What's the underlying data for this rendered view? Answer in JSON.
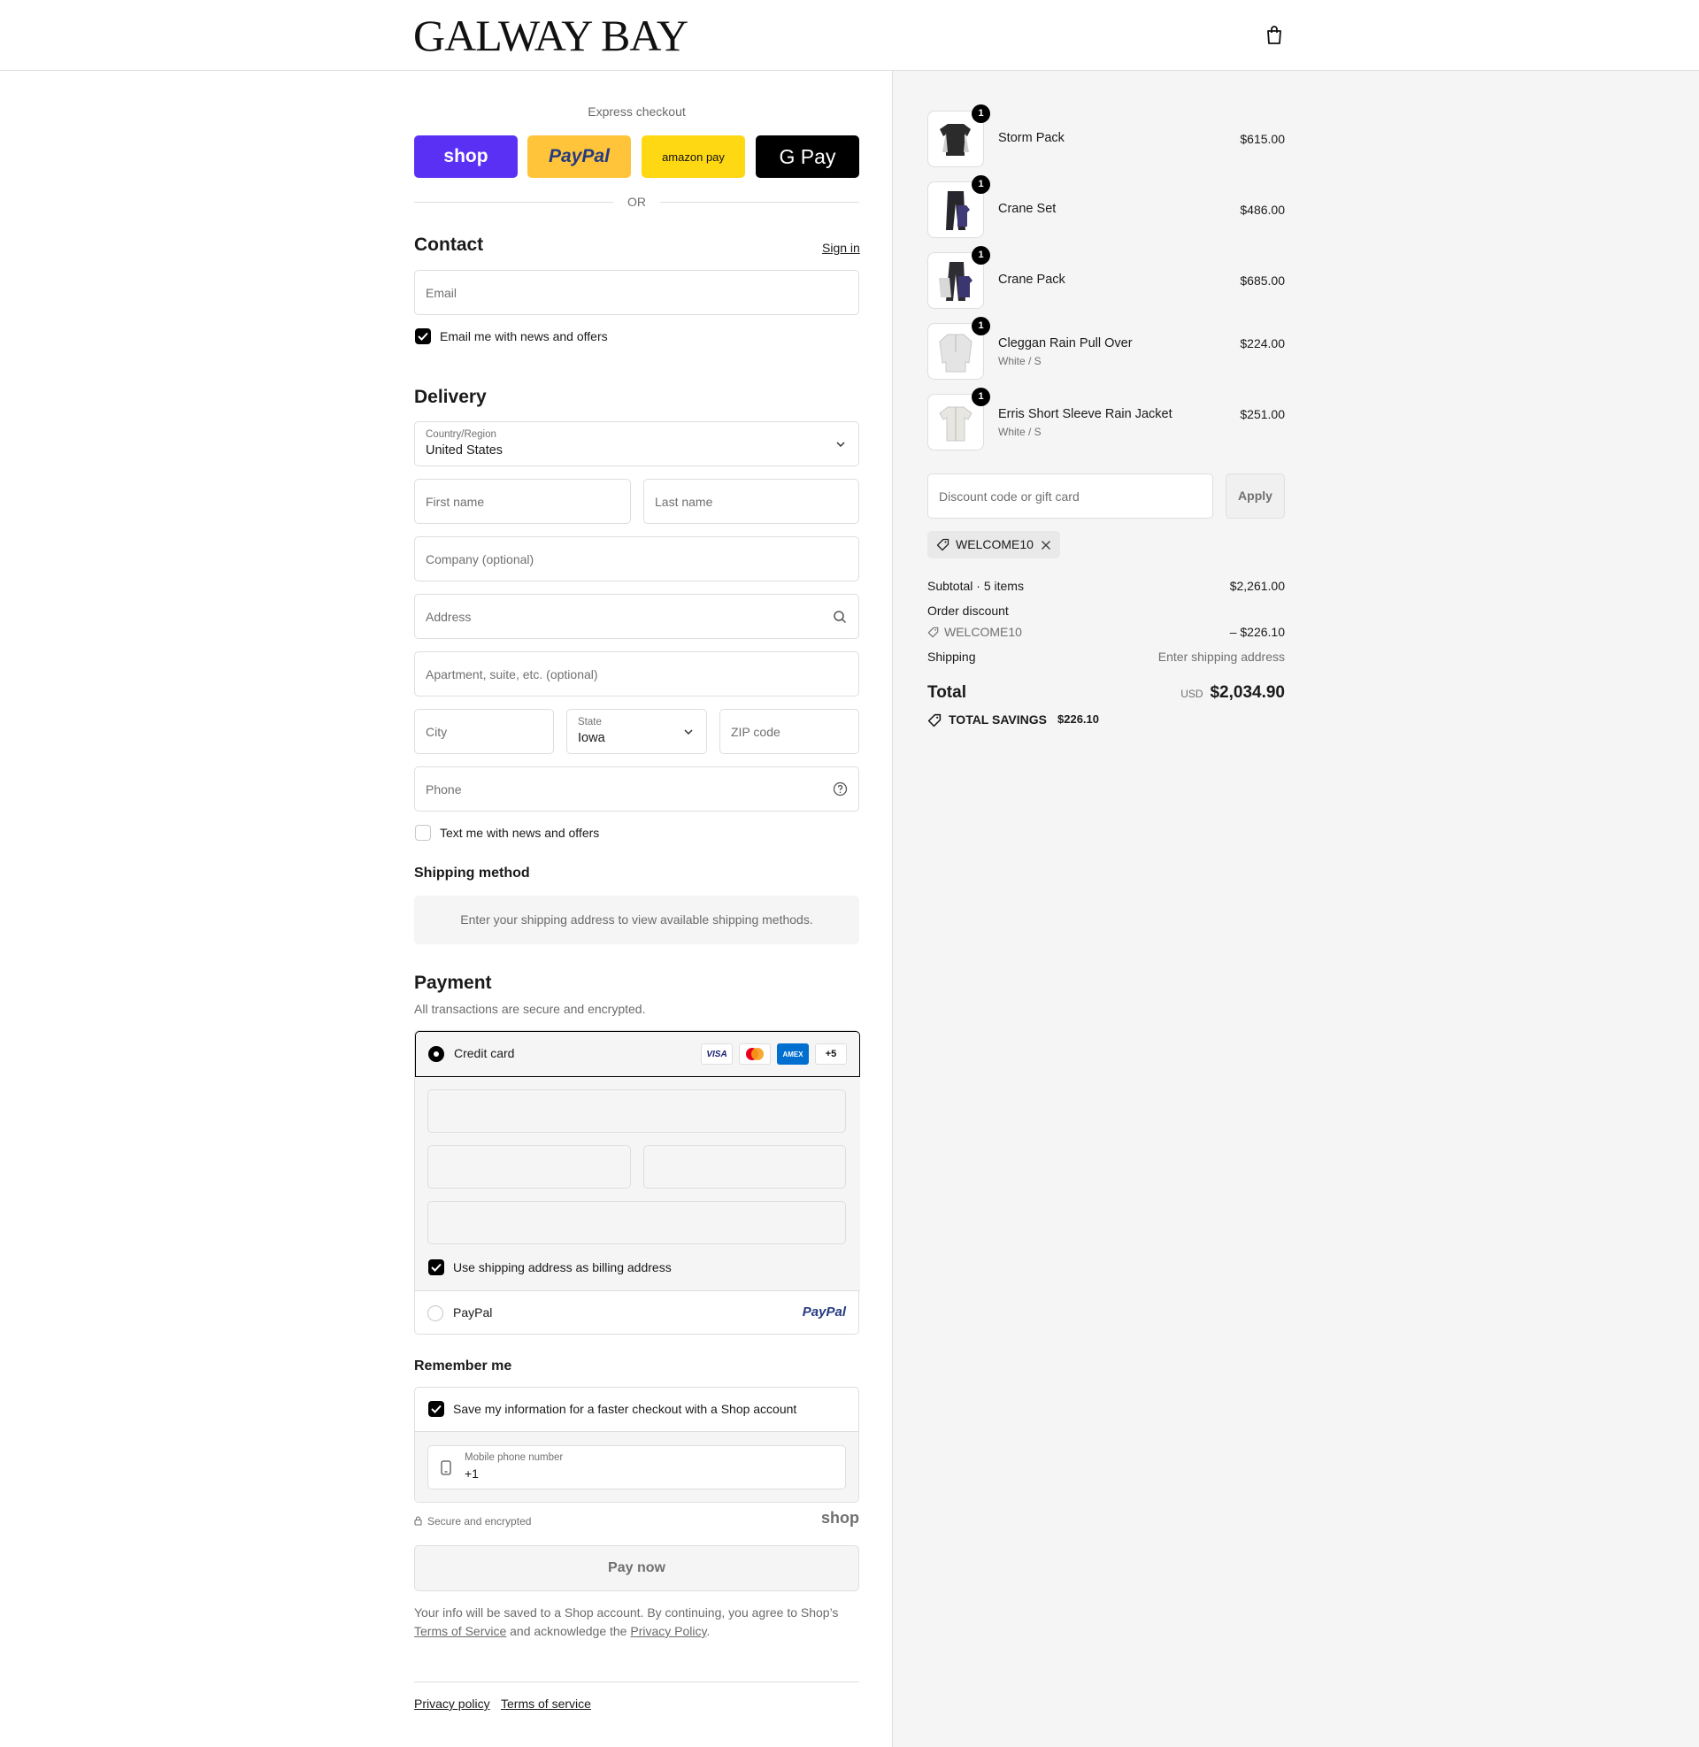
{
  "header": {
    "logo": "GALWAY BAY",
    "cart_icon": "bag-icon"
  },
  "express": {
    "title": "Express checkout",
    "buttons": [
      {
        "label": "shop",
        "color": "#5a31f4",
        "text_color": "#ffffff"
      },
      {
        "label": "PayPal",
        "color": "#ffc439",
        "text_color": "#253b80"
      },
      {
        "label": "amazon pay",
        "color": "#ffd814",
        "text_color": "#111111"
      },
      {
        "label": "G Pay",
        "color": "#000000",
        "text_color": "#ffffff"
      }
    ],
    "or": "OR"
  },
  "contact": {
    "title": "Contact",
    "sign_in": "Sign in",
    "email_placeholder": "Email",
    "news_label": "Email me with news and offers"
  },
  "delivery": {
    "title": "Delivery",
    "country_label": "Country/Region",
    "country_value": "United States",
    "first_name": "First name",
    "last_name": "Last name",
    "company": "Company (optional)",
    "address": "Address",
    "apartment": "Apartment, suite, etc. (optional)",
    "city": "City",
    "state_label": "State",
    "state_value": "Iowa",
    "zip": "ZIP code",
    "phone": "Phone",
    "text_news": "Text me with news and offers"
  },
  "shipping_method": {
    "title": "Shipping method",
    "message": "Enter your shipping address to view available shipping methods."
  },
  "payment": {
    "title": "Payment",
    "subtitle": "All transactions are secure and encrypted.",
    "credit_card": "Credit card",
    "card_logos": [
      "VISA",
      "mastercard",
      "AMEX",
      "+5"
    ],
    "billing_label": "Use shipping address as billing address",
    "paypal_label": "PayPal",
    "paypal_logo": "PayPal"
  },
  "remember": {
    "title": "Remember me",
    "save_label": "Save my information for a faster checkout with a Shop account",
    "phone_label": "Mobile phone number",
    "phone_value": "+1"
  },
  "secure": {
    "label": "Secure and encrypted",
    "shop_logo": "shop"
  },
  "pay_now": "Pay now",
  "legal": {
    "text1": "Your info will be saved to a Shop account. By continuing, you agree to Shop’s",
    "terms": "Terms of Service",
    "text2": " and acknowledge the ",
    "privacy": "Privacy Policy",
    "text3": "."
  },
  "footer": {
    "privacy": "Privacy policy",
    "terms": "Terms of service"
  },
  "cart": {
    "items": [
      {
        "name": "Storm Pack",
        "variant": "",
        "price": "$615.00",
        "qty": "1"
      },
      {
        "name": "Crane Set",
        "variant": "",
        "price": "$486.00",
        "qty": "1"
      },
      {
        "name": "Crane Pack",
        "variant": "",
        "price": "$685.00",
        "qty": "1"
      },
      {
        "name": "Cleggan Rain Pull Over",
        "variant": "White / S",
        "price": "$224.00",
        "qty": "1"
      },
      {
        "name": "Erris Short Sleeve Rain Jacket",
        "variant": "White / S",
        "price": "$251.00",
        "qty": "1"
      }
    ],
    "discount_placeholder": "Discount code or gift card",
    "apply": "Apply",
    "applied_code": "WELCOME10",
    "subtotal_label": "Subtotal · 5 items",
    "subtotal_value": "$2,261.00",
    "order_discount_label": "Order discount",
    "discount_code": "WELCOME10",
    "discount_value": "– $226.10",
    "shipping_label": "Shipping",
    "shipping_value": "Enter shipping address",
    "total_label": "Total",
    "currency": "USD",
    "total_value": "$2,034.90",
    "savings_label": "TOTAL SAVINGS",
    "savings_value": "$226.10"
  }
}
